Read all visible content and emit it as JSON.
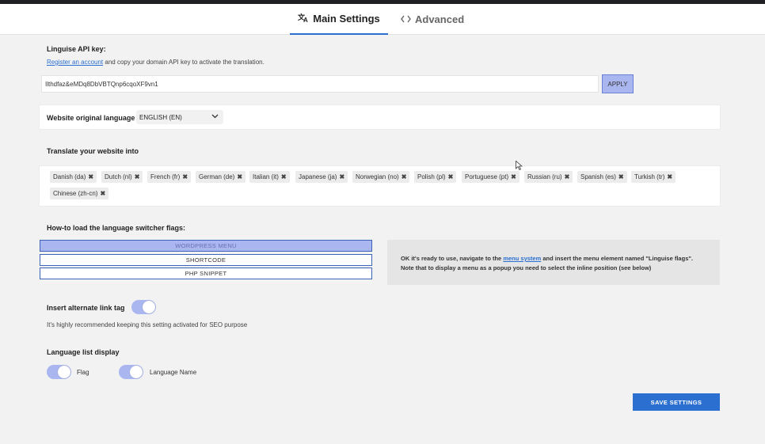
{
  "tabs": {
    "main_icon": "translate-icon",
    "main_label": "Main Settings",
    "advanced_icon": "code-icon",
    "advanced_label": "Advanced"
  },
  "api": {
    "label": "Linguise API key:",
    "register_link": "Register an account",
    "register_rest": " and copy your domain API key to activate the translation.",
    "key_value": "Ilthdfaz&eMDq8DbVBTQnp6cqoXF9vn1",
    "apply_label": "APPLY"
  },
  "original_language": {
    "label": "Website original language",
    "selected": "ENGLISH (EN)"
  },
  "translate": {
    "label": "Translate your website into",
    "languages": [
      "Danish (da)",
      "Dutch (nl)",
      "French (fr)",
      "German (de)",
      "Italian (it)",
      "Japanese (ja)",
      "Norwegian (no)",
      "Polish (pl)",
      "Portuguese (pt)",
      "Russian (ru)",
      "Spanish (es)",
      "Turkish (tr)",
      "Chinese (zh-cn)"
    ],
    "remove_glyph": "✖"
  },
  "flags": {
    "label": "How-to load the language switcher flags:",
    "options": [
      "WORDPRESS MENU",
      "SHORTCODE",
      "PHP SNIPPET"
    ],
    "info_pre": "OK it's ready to use, navigate to the ",
    "info_link": "menu system",
    "info_post": " and insert the menu element named \"Linguise flags\".",
    "info_line2": "Note that to display a menu as a popup you need to select the inline position (see below)"
  },
  "alternate": {
    "label": "Insert alternate link tag",
    "enabled": true,
    "help": "It's highly recommended keeping this setting activated for SEO purpose"
  },
  "list_display": {
    "label": "Language list display",
    "flag_label": "Flag",
    "flag_enabled": true,
    "name_label": "Language Name",
    "name_enabled": true
  },
  "save_label": "SAVE SETTINGS",
  "colors": {
    "accent": "#2b6fd1",
    "toggle_on": "#aab6ef"
  }
}
